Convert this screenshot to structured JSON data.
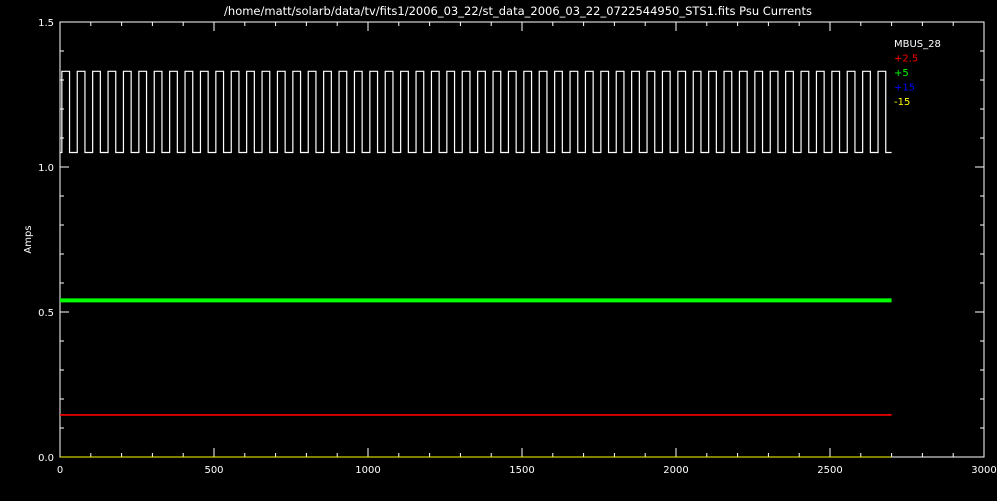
{
  "chart_data": {
    "type": "line",
    "title": "/home/matt/solarb/data/tv/fits1/2006_03_22/st_data_2006_03_22_0722544950_STS1.fits Psu Currents",
    "xlabel": "",
    "ylabel": "Amps",
    "xlim": [
      0,
      3000
    ],
    "ylim": [
      0,
      1.5
    ],
    "x_ticks": [
      "0",
      "500",
      "1000",
      "1500",
      "2000",
      "2500",
      "3000"
    ],
    "y_ticks": [
      "0.0",
      "0.5",
      "1.0",
      "1.5"
    ],
    "x_end": 2700,
    "legend_position": "top-right",
    "series": [
      {
        "name": "MBUS_28",
        "color": "#ffffff",
        "pattern": "square_wave",
        "high": 1.33,
        "low": 1.05,
        "cycles": 54
      },
      {
        "name": "+2.5",
        "color": "#ff0000",
        "pattern": "constant",
        "value": 0.145
      },
      {
        "name": "+5",
        "color": "#00ff00",
        "pattern": "constant",
        "value": 0.54
      },
      {
        "name": "+15",
        "color": "#0000ff",
        "pattern": "constant",
        "value": 0.0
      },
      {
        "name": "-15",
        "color": "#ffff00",
        "pattern": "constant",
        "value": 0.0
      }
    ]
  }
}
